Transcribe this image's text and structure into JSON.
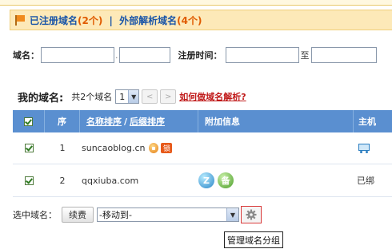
{
  "tabs": {
    "registered_label": "已注册域名",
    "registered_count": "(2个)",
    "separator": "|",
    "external_label": "外部解析域名",
    "external_count": "(4个)"
  },
  "filter": {
    "domain_label": "域名：",
    "domain_value": "",
    "dot": ".",
    "tld_value": "",
    "reg_time_label": "注册时间：",
    "date_from": "",
    "to_label": "至",
    "date_to": ""
  },
  "list": {
    "title": "我的域名:",
    "count_text": "共2个域名",
    "page_value": "1",
    "prev_arrow": "<",
    "next_arrow": ">",
    "help_link": "如何做域名解析?"
  },
  "table": {
    "headers": {
      "seq": "序",
      "name_sort": "名称排序",
      "slash": "/",
      "suffix_sort": "后缀排序",
      "extra": "附加信息",
      "host": "主机"
    },
    "rows": [
      {
        "seq": "1",
        "domain": "suncaoblog.cn",
        "badge_text": "锁",
        "host": "",
        "host_icon": "cart-icon"
      },
      {
        "seq": "2",
        "domain": "qqxiuba.com",
        "badge1_text": "Z",
        "badge2_text": "备",
        "host": "已绑"
      }
    ]
  },
  "bottom": {
    "selected_label": "选中域名：",
    "renew_button": "续费",
    "move_select_value": "-移动到-",
    "tooltip": "管理域名分组"
  },
  "colors": {
    "header_blue": "#5a8fd0",
    "tab_bg": "#fde9b8",
    "link_blue": "#1a55a8",
    "count_orange": "#e05b00",
    "help_red": "#c01a1a"
  }
}
